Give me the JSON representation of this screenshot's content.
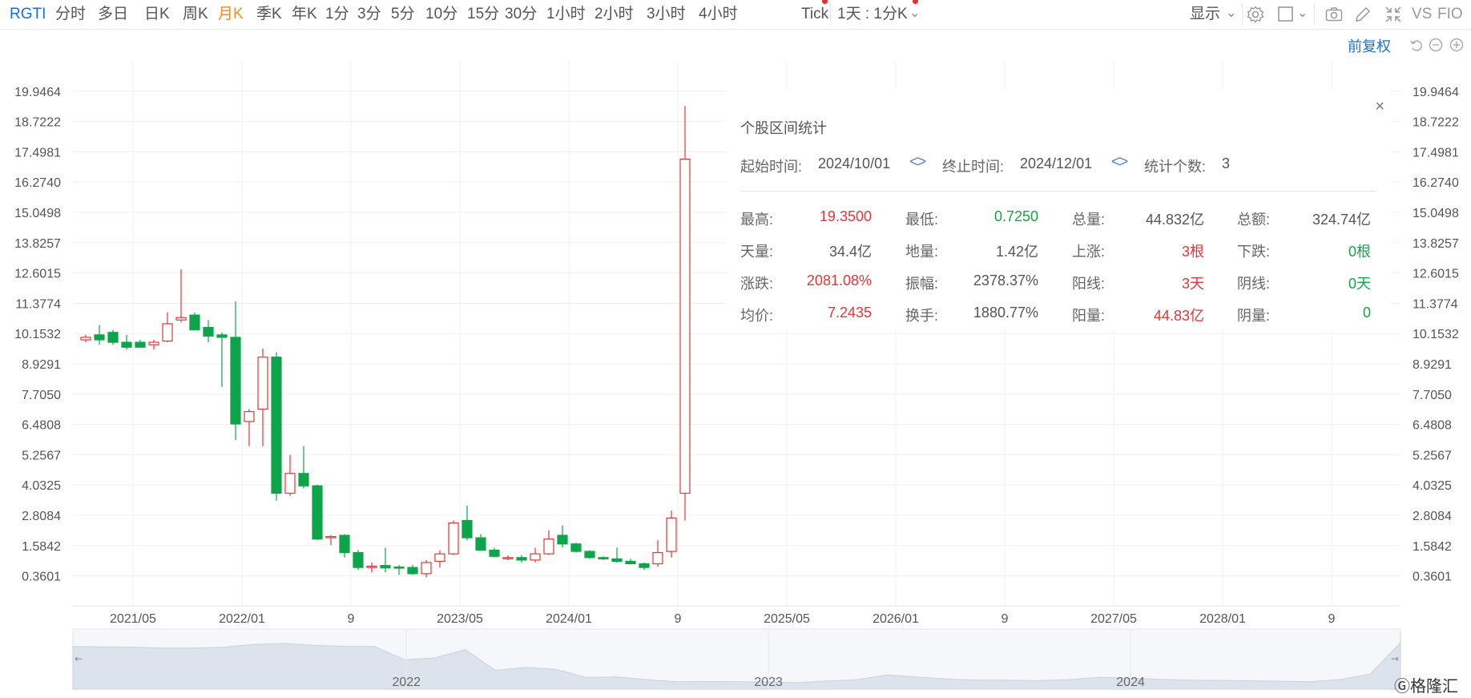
{
  "toolbar": {
    "symbol": "RGTI",
    "periods": [
      "分时",
      "多日",
      "日K",
      "周K",
      "月K",
      "季K",
      "年K",
      "1分",
      "3分",
      "5分",
      "10分",
      "15分",
      "30分",
      "1小时",
      "2小时",
      "3小时",
      "4小时",
      "Tick"
    ],
    "active_period": "月K",
    "mode_select": "1天 : 1分K",
    "display_label": "显示",
    "vs_label": "VS",
    "fio_label": "FIO"
  },
  "adjust_label": "前复权",
  "colors": {
    "up": "#e5363a",
    "down": "#0ea54a",
    "accent": "#1d6fd6",
    "active": "#f08b1e"
  },
  "icons": [
    "chevron-down-icon",
    "gear-icon",
    "square-icon",
    "camera-icon",
    "pencil-icon",
    "shrink-icon",
    "undo-icon",
    "zoom-out-icon",
    "zoom-in-icon",
    "close-icon"
  ],
  "stats": {
    "title": "个股区间统计",
    "start_label": "起始时间:",
    "start_value": "2024/10/01",
    "end_label": "终止时间:",
    "end_value": "2024/12/01",
    "count_label": "统计个数:",
    "count_value": "3",
    "rows": [
      [
        {
          "label": "最高:",
          "value": "19.3500",
          "color": "red"
        },
        {
          "label": "最低:",
          "value": "0.7250",
          "color": "green"
        },
        {
          "label": "总量:",
          "value": "44.832亿",
          "color": "grey"
        },
        {
          "label": "总额:",
          "value": "324.74亿",
          "color": "grey"
        }
      ],
      [
        {
          "label": "天量:",
          "value": "34.4亿",
          "color": "grey"
        },
        {
          "label": "地量:",
          "value": "1.42亿",
          "color": "grey"
        },
        {
          "label": "上涨:",
          "value": "3根",
          "color": "red"
        },
        {
          "label": "下跌:",
          "value": "0根",
          "color": "green"
        }
      ],
      [
        {
          "label": "涨跌:",
          "value": "2081.08%",
          "color": "red"
        },
        {
          "label": "振幅:",
          "value": "2378.37%",
          "color": "grey"
        },
        {
          "label": "阳线:",
          "value": "3天",
          "color": "red"
        },
        {
          "label": "阴线:",
          "value": "0天",
          "color": "green"
        }
      ],
      [
        {
          "label": "均价:",
          "value": "7.2435",
          "color": "red"
        },
        {
          "label": "换手:",
          "value": "1880.77%",
          "color": "grey"
        },
        {
          "label": "阳量:",
          "value": "44.83亿",
          "color": "red"
        },
        {
          "label": "阴量:",
          "value": "0",
          "color": "green"
        }
      ]
    ]
  },
  "chart_data": {
    "type": "candlestick",
    "ylim": [
      -0.85,
      21.17
    ],
    "y_ticks": [
      "19.9464",
      "18.7222",
      "17.4981",
      "16.2740",
      "15.0498",
      "13.8257",
      "12.6015",
      "11.3774",
      "10.1532",
      "8.9291",
      "7.7050",
      "6.4808",
      "5.2567",
      "4.0325",
      "2.8084",
      "1.5842",
      "0.3601"
    ],
    "y_tick_values": [
      19.9464,
      18.7222,
      17.4981,
      16.274,
      15.0498,
      13.8257,
      12.6015,
      11.3774,
      10.1532,
      8.9291,
      7.705,
      6.4808,
      5.2567,
      4.0325,
      2.8084,
      1.5842,
      0.3601
    ],
    "x_ticks": [
      {
        "label": "2021/05",
        "month": 3
      },
      {
        "label": "2022/01",
        "month": 11
      },
      {
        "label": "9",
        "month": 19
      },
      {
        "label": "2023/05",
        "month": 27
      },
      {
        "label": "2024/01",
        "month": 35
      },
      {
        "label": "9",
        "month": 43
      },
      {
        "label": "2025/05",
        "month": 51
      },
      {
        "label": "2026/01",
        "month": 59
      },
      {
        "label": "9",
        "month": 67
      },
      {
        "label": "2027/05",
        "month": 75
      },
      {
        "label": "2028/01",
        "month": 83
      },
      {
        "label": "9",
        "month": 91
      }
    ],
    "months_visible": 97,
    "candles": [
      {
        "o": 9.9,
        "h": 10.1,
        "l": 9.8,
        "c": 10.0
      },
      {
        "o": 10.1,
        "h": 10.5,
        "l": 9.7,
        "c": 9.9
      },
      {
        "o": 10.2,
        "h": 10.3,
        "l": 9.7,
        "c": 9.8
      },
      {
        "o": 9.8,
        "h": 10.1,
        "l": 9.5,
        "c": 9.6
      },
      {
        "o": 9.8,
        "h": 9.9,
        "l": 9.6,
        "c": 9.6
      },
      {
        "o": 9.7,
        "h": 9.9,
        "l": 9.5,
        "c": 9.8
      },
      {
        "o": 9.85,
        "h": 11.0,
        "l": 9.8,
        "c": 10.55
      },
      {
        "o": 10.7,
        "h": 12.75,
        "l": 10.6,
        "c": 10.8
      },
      {
        "o": 10.9,
        "h": 11.0,
        "l": 10.3,
        "c": 10.3
      },
      {
        "o": 10.4,
        "h": 10.7,
        "l": 9.8,
        "c": 10.05
      },
      {
        "o": 10.1,
        "h": 10.2,
        "l": 8.0,
        "c": 10.0
      },
      {
        "o": 10.0,
        "h": 11.45,
        "l": 5.85,
        "c": 6.5
      },
      {
        "o": 6.6,
        "h": 7.1,
        "l": 5.6,
        "c": 7.0
      },
      {
        "o": 7.1,
        "h": 9.55,
        "l": 5.6,
        "c": 9.2
      },
      {
        "o": 9.2,
        "h": 9.4,
        "l": 3.4,
        "c": 3.7
      },
      {
        "o": 3.7,
        "h": 5.25,
        "l": 3.6,
        "c": 4.5
      },
      {
        "o": 4.5,
        "h": 5.6,
        "l": 3.9,
        "c": 4.0
      },
      {
        "o": 4.0,
        "h": 4.05,
        "l": 1.8,
        "c": 1.85
      },
      {
        "o": 1.9,
        "h": 2.0,
        "l": 1.6,
        "c": 1.95
      },
      {
        "o": 2.0,
        "h": 2.05,
        "l": 1.1,
        "c": 1.3
      },
      {
        "o": 1.3,
        "h": 1.4,
        "l": 0.6,
        "c": 0.7
      },
      {
        "o": 0.7,
        "h": 0.9,
        "l": 0.5,
        "c": 0.75
      },
      {
        "o": 0.78,
        "h": 1.5,
        "l": 0.5,
        "c": 0.68
      },
      {
        "o": 0.72,
        "h": 0.8,
        "l": 0.4,
        "c": 0.7
      },
      {
        "o": 0.7,
        "h": 0.8,
        "l": 0.4,
        "c": 0.45
      },
      {
        "o": 0.45,
        "h": 1.0,
        "l": 0.3,
        "c": 0.9
      },
      {
        "o": 0.95,
        "h": 1.4,
        "l": 0.7,
        "c": 1.25
      },
      {
        "o": 1.25,
        "h": 2.6,
        "l": 1.2,
        "c": 2.5
      },
      {
        "o": 2.6,
        "h": 3.2,
        "l": 1.8,
        "c": 1.9
      },
      {
        "o": 1.9,
        "h": 2.05,
        "l": 1.4,
        "c": 1.4
      },
      {
        "o": 1.4,
        "h": 1.5,
        "l": 1.1,
        "c": 1.15
      },
      {
        "o": 1.1,
        "h": 1.2,
        "l": 1.0,
        "c": 1.1
      },
      {
        "o": 1.1,
        "h": 1.2,
        "l": 0.9,
        "c": 1.0
      },
      {
        "o": 1.0,
        "h": 1.5,
        "l": 0.9,
        "c": 1.25
      },
      {
        "o": 1.25,
        "h": 2.2,
        "l": 1.2,
        "c": 1.85
      },
      {
        "o": 2.0,
        "h": 2.4,
        "l": 1.5,
        "c": 1.65
      },
      {
        "o": 1.65,
        "h": 1.7,
        "l": 1.3,
        "c": 1.35
      },
      {
        "o": 1.35,
        "h": 1.4,
        "l": 1.05,
        "c": 1.1
      },
      {
        "o": 1.1,
        "h": 1.15,
        "l": 1.0,
        "c": 1.05
      },
      {
        "o": 1.05,
        "h": 1.5,
        "l": 0.9,
        "c": 0.95
      },
      {
        "o": 0.95,
        "h": 1.05,
        "l": 0.85,
        "c": 0.85
      },
      {
        "o": 0.85,
        "h": 0.9,
        "l": 0.6,
        "c": 0.7
      },
      {
        "o": 0.85,
        "h": 1.8,
        "l": 0.73,
        "c": 1.3
      },
      {
        "o": 1.35,
        "h": 3.0,
        "l": 1.1,
        "c": 2.7
      },
      {
        "o": 3.7,
        "h": 19.35,
        "l": 2.6,
        "c": 17.2
      }
    ],
    "navigator": {
      "labels": [
        {
          "label": "2022",
          "month": 11
        },
        {
          "label": "2023",
          "month": 23
        },
        {
          "label": "2024",
          "month": 35
        }
      ]
    }
  }
}
